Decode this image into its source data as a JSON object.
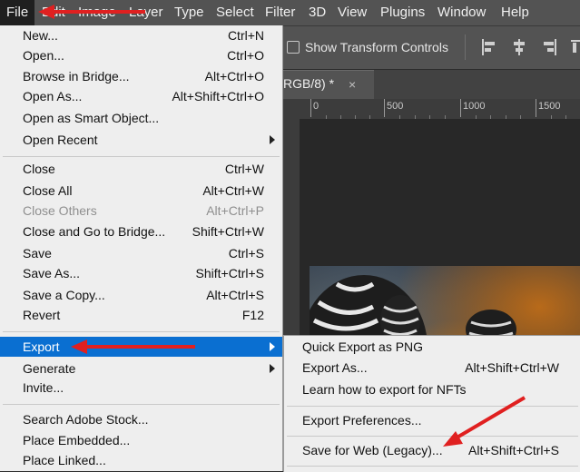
{
  "menubar": {
    "items": [
      "File",
      "Edit",
      "Image",
      "Layer",
      "Type",
      "Select",
      "Filter",
      "3D",
      "View",
      "Plugins",
      "Window",
      "Help"
    ]
  },
  "options": {
    "show_transform_controls": "Show Transform Controls"
  },
  "document_tab": {
    "title": "RGB/8) *",
    "close_glyph": "×"
  },
  "ruler": {
    "labels": [
      "0",
      "500",
      "1000",
      "1500"
    ]
  },
  "file_menu": {
    "groups": [
      [
        {
          "label": "New...",
          "shortcut": "Ctrl+N"
        },
        {
          "label": "Open...",
          "shortcut": "Ctrl+O"
        },
        {
          "label": "Browse in Bridge...",
          "shortcut": "Alt+Ctrl+O"
        },
        {
          "label": "Open As...",
          "shortcut": "Alt+Shift+Ctrl+O"
        },
        {
          "label": "Open as Smart Object...",
          "shortcut": ""
        },
        {
          "label": "Open Recent",
          "shortcut": "",
          "submenu": true
        }
      ],
      [
        {
          "label": "Close",
          "shortcut": "Ctrl+W"
        },
        {
          "label": "Close All",
          "shortcut": "Alt+Ctrl+W"
        },
        {
          "label": "Close Others",
          "shortcut": "Alt+Ctrl+P",
          "disabled": true
        },
        {
          "label": "Close and Go to Bridge...",
          "shortcut": "Shift+Ctrl+W"
        },
        {
          "label": "Save",
          "shortcut": "Ctrl+S"
        },
        {
          "label": "Save As...",
          "shortcut": "Shift+Ctrl+S"
        },
        {
          "label": "Save a Copy...",
          "shortcut": "Alt+Ctrl+S"
        },
        {
          "label": "Revert",
          "shortcut": "F12"
        }
      ],
      [
        {
          "label": "Export",
          "shortcut": "",
          "submenu": true,
          "highlight": true
        },
        {
          "label": "Generate",
          "shortcut": "",
          "submenu": true
        },
        {
          "label": "Invite...",
          "shortcut": ""
        }
      ],
      [
        {
          "label": "Search Adobe Stock...",
          "shortcut": ""
        },
        {
          "label": "Place Embedded...",
          "shortcut": ""
        },
        {
          "label": "Place Linked...",
          "shortcut": ""
        }
      ]
    ]
  },
  "export_submenu": {
    "groups": [
      [
        {
          "label": "Quick Export as PNG",
          "shortcut": ""
        },
        {
          "label": "Export As...",
          "shortcut": "Alt+Shift+Ctrl+W"
        },
        {
          "label": "Learn how to export for NFTs",
          "shortcut": ""
        }
      ],
      [
        {
          "label": "Export Preferences...",
          "shortcut": ""
        }
      ],
      [
        {
          "label": "Save for Web (Legacy)...",
          "shortcut": "Alt+Shift+Ctrl+S"
        }
      ]
    ]
  },
  "colors": {
    "annotation_arrow": "#e02020",
    "menu_highlight": "#0a6fd1"
  }
}
